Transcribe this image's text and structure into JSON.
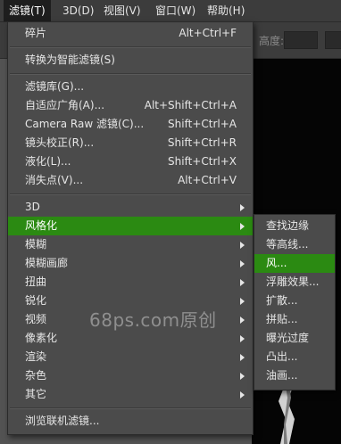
{
  "menubar": {
    "items": [
      "滤镜(T)",
      "3D(D)",
      "视图(V)",
      "窗口(W)",
      "帮助(H)"
    ],
    "active_index": 0
  },
  "options_bar": {
    "partial_label": "高度:"
  },
  "filter_menu": {
    "last_filter": {
      "label": "碎片",
      "shortcut": "Alt+Ctrl+F"
    },
    "convert_smart": {
      "label": "转换为智能滤镜(S)"
    },
    "gallery": {
      "label": "滤镜库(G)..."
    },
    "adaptive_wide": {
      "label": "自适应广角(A)...",
      "shortcut": "Alt+Shift+Ctrl+A"
    },
    "camera_raw": {
      "label": "Camera Raw 滤镜(C)...",
      "shortcut": "Shift+Ctrl+A"
    },
    "lens_correction": {
      "label": "镜头校正(R)...",
      "shortcut": "Shift+Ctrl+R"
    },
    "liquify": {
      "label": "液化(L)...",
      "shortcut": "Shift+Ctrl+X"
    },
    "vanishing_point": {
      "label": "消失点(V)...",
      "shortcut": "Alt+Ctrl+V"
    },
    "submenus": [
      "3D",
      "风格化",
      "模糊",
      "模糊画廊",
      "扭曲",
      "锐化",
      "视频",
      "像素化",
      "渲染",
      "杂色",
      "其它"
    ],
    "highlighted_submenu": "风格化",
    "browse_online": {
      "label": "浏览联机滤镜..."
    }
  },
  "stylize_submenu": {
    "items": [
      "查找边缘",
      "等高线...",
      "风...",
      "浮雕效果...",
      "扩散...",
      "拼贴...",
      "曝光过度",
      "凸出...",
      "油画..."
    ],
    "highlighted": "风..."
  },
  "watermark": {
    "text": "68ps.com原创"
  },
  "colors": {
    "highlight": "#2b8a12",
    "menu_bg": "#4b4b4b",
    "menubar_bg": "#3c3c3c",
    "text": "#e6e6e6"
  }
}
